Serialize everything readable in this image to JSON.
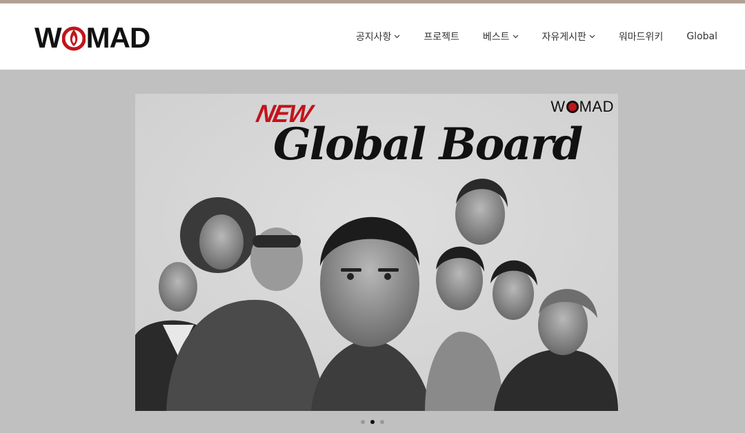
{
  "header": {
    "logo_text": "WOMAD",
    "nav": [
      {
        "label": "공지사항",
        "dropdown": true
      },
      {
        "label": "프로젝트",
        "dropdown": false
      },
      {
        "label": "베스트",
        "dropdown": true
      },
      {
        "label": "자유게시판",
        "dropdown": true
      },
      {
        "label": "워마드위키",
        "dropdown": false
      },
      {
        "label": "Global",
        "dropdown": false
      }
    ]
  },
  "hero": {
    "badge": "NEW",
    "title": "Global Board",
    "banner_logo": "WOMAD",
    "slides": 3,
    "active_slide": 2
  },
  "colors": {
    "top_strip": "#b3a094",
    "accent_red": "#c2141b",
    "hero_bg": "#c0c0c0"
  }
}
